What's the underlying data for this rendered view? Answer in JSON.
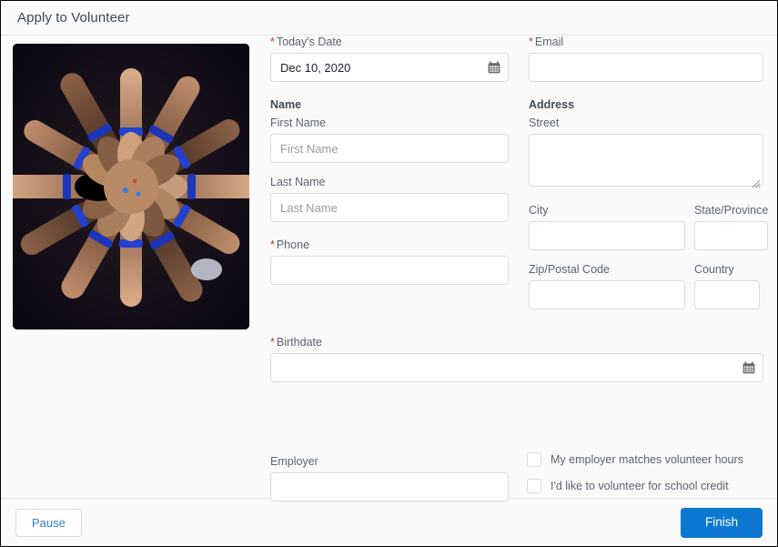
{
  "header": {
    "title": "Apply to Volunteer"
  },
  "hero": {
    "alt": "circle-of-hands-photo",
    "icon": "hands-circle-image"
  },
  "form": {
    "todays_date": {
      "label": "Today's Date",
      "required_mark": "*",
      "value": "Dec 10, 2020",
      "placeholder": "",
      "icon": "calendar-icon"
    },
    "name_section": {
      "heading": "Name"
    },
    "first_name": {
      "label": "First Name",
      "value": "",
      "placeholder": "First Name"
    },
    "last_name": {
      "label": "Last Name",
      "value": "",
      "placeholder": "Last Name"
    },
    "phone": {
      "label": "Phone",
      "required_mark": "*",
      "value": "",
      "placeholder": ""
    },
    "email": {
      "label": "Email",
      "required_mark": "*",
      "value": "",
      "placeholder": ""
    },
    "address_section": {
      "heading": "Address"
    },
    "street": {
      "label": "Street",
      "value": "",
      "placeholder": ""
    },
    "city": {
      "label": "City",
      "value": "",
      "placeholder": ""
    },
    "state": {
      "label": "State/Province",
      "value": "",
      "placeholder": ""
    },
    "zip": {
      "label": "Zip/Postal Code",
      "value": "",
      "placeholder": ""
    },
    "country": {
      "label": "Country",
      "value": "",
      "placeholder": ""
    },
    "birthdate": {
      "label": "Birthdate",
      "required_mark": "*",
      "value": "",
      "placeholder": "",
      "icon": "calendar-icon"
    },
    "employer": {
      "label": "Employer",
      "value": "",
      "placeholder": ""
    },
    "checkboxes": [
      {
        "label": "My employer matches volunteer hours",
        "checked": false
      },
      {
        "label": "I'd like to volunteer for school credit",
        "checked": false
      }
    ]
  },
  "footer": {
    "pause_label": "Pause",
    "finish_label": "Finish"
  },
  "colors": {
    "brand_blue": "#0d78d1",
    "link_blue": "#2a7ed3",
    "required_red": "#c23934",
    "label_gray": "#5c6370",
    "border_gray": "#dddbda",
    "page_bg": "#fafafa"
  }
}
